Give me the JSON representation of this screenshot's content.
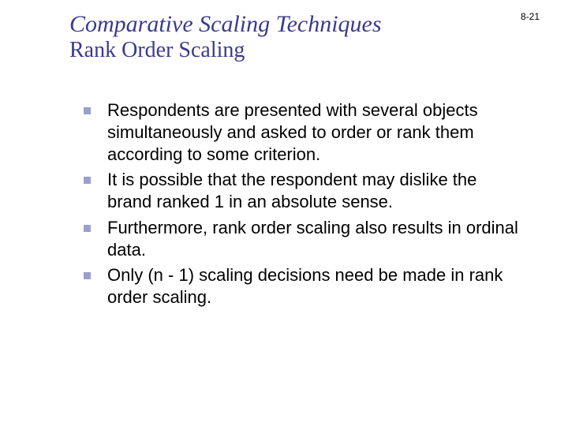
{
  "page_number": "8-21",
  "title": {
    "main": "Comparative Scaling Techniques",
    "sub": "Rank Order Scaling"
  },
  "bullets": [
    "Respondents are presented with several objects simultaneously and asked to order or rank them according to some criterion.",
    "It is possible that the respondent may dislike the brand ranked 1 in an absolute sense.",
    "Furthermore, rank order scaling also results in ordinal data.",
    "Only (n - 1) scaling decisions need be made in rank order scaling."
  ]
}
